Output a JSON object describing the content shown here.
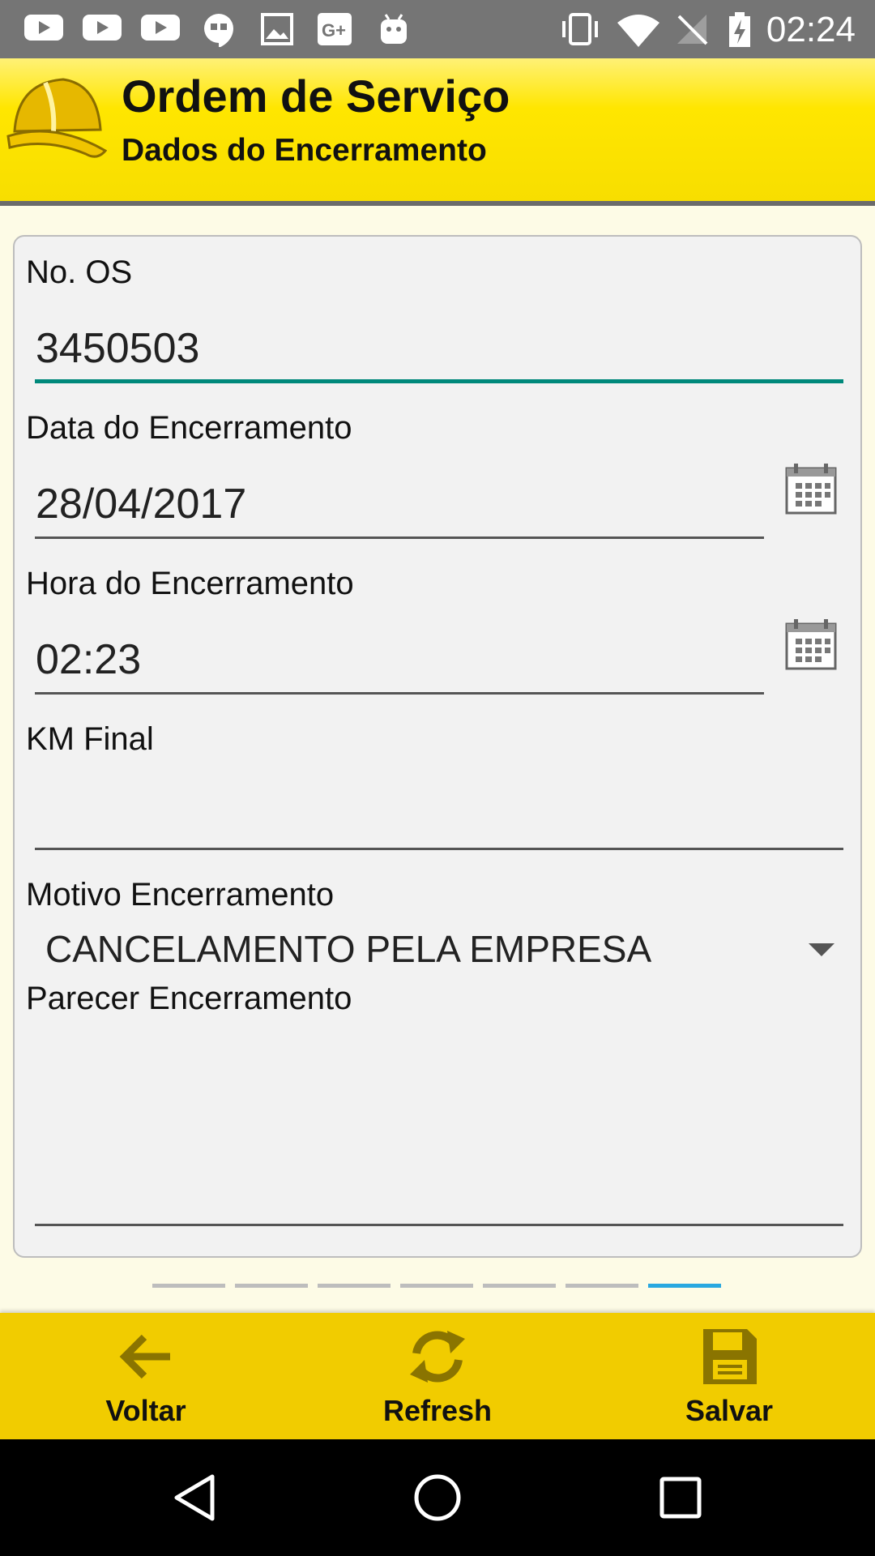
{
  "status_bar": {
    "time": "02:24",
    "notification_icons": [
      "youtube-icon",
      "youtube-icon",
      "youtube-icon",
      "hangouts-icon",
      "image-icon",
      "google-plus-icon",
      "android-icon"
    ],
    "system_icons": [
      "vibrate-icon",
      "wifi-icon",
      "no-signal-icon",
      "battery-charging-icon"
    ]
  },
  "header": {
    "title": "Ordem de Serviço",
    "subtitle": "Dados do Encerramento",
    "icon": "helmet-icon"
  },
  "form": {
    "os_number": {
      "label": "No. OS",
      "value": "3450503"
    },
    "close_date": {
      "label": "Data do Encerramento",
      "value": "28/04/2017"
    },
    "close_time": {
      "label": "Hora do Encerramento",
      "value": "02:23"
    },
    "km_final": {
      "label": "KM Final",
      "value": ""
    },
    "close_reason": {
      "label": "Motivo Encerramento",
      "value": "CANCELAMENTO PELA EMPRESA"
    },
    "close_opinion": {
      "label": "Parecer Encerramento",
      "value": ""
    }
  },
  "pager": {
    "total": 7,
    "current": 7
  },
  "toolbar": {
    "back_label": "Voltar",
    "refresh_label": "Refresh",
    "save_label": "Salvar"
  },
  "colors": {
    "header_yellow": "#ffe600",
    "toolbar_yellow": "#f1cc00",
    "active_underline": "#00897b",
    "pager_active": "#29a8e0",
    "icon_olive": "#8a7400"
  }
}
